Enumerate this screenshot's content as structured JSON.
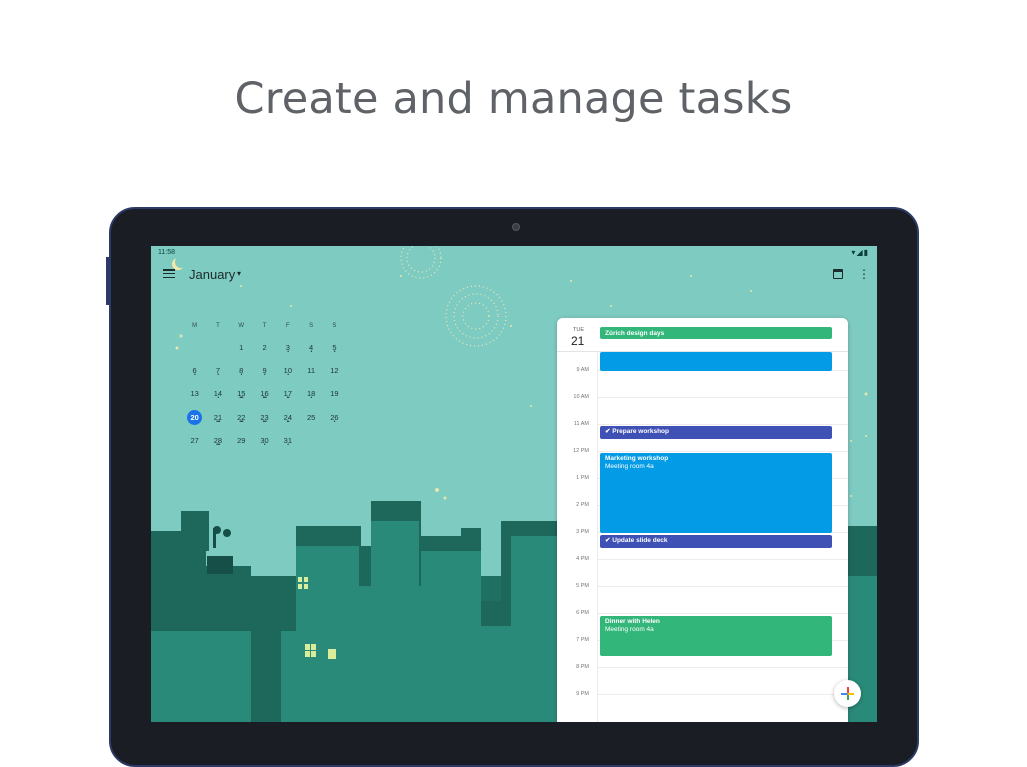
{
  "headline": "Create and manage tasks",
  "status_bar": {
    "time": "11:58",
    "icons": "▾◢▮"
  },
  "app_bar": {
    "month": "January",
    "caret": "▾",
    "more": "⋮"
  },
  "mini_calendar": {
    "weekdays": [
      "M",
      "T",
      "W",
      "T",
      "F",
      "S",
      "S"
    ],
    "weeks": [
      [
        {
          "d": ""
        },
        {
          "d": ""
        },
        {
          "d": "1"
        },
        {
          "d": "2"
        },
        {
          "d": "3",
          "dots": "•"
        },
        {
          "d": "4",
          "dots": "•"
        },
        {
          "d": "5",
          "dots": "•"
        }
      ],
      [
        {
          "d": "6",
          "dots": "•"
        },
        {
          "d": "7",
          "dots": "•"
        },
        {
          "d": "8",
          "dots": "•"
        },
        {
          "d": "9",
          "dots": "•"
        },
        {
          "d": "10",
          "dots": "•"
        },
        {
          "d": "11"
        },
        {
          "d": "12"
        }
      ],
      [
        {
          "d": "13"
        },
        {
          "d": "14",
          "dots": "•"
        },
        {
          "d": "15",
          "dots": "•••"
        },
        {
          "d": "16",
          "dots": "•••"
        },
        {
          "d": "17",
          "dots": "••"
        },
        {
          "d": "18",
          "dots": "•"
        },
        {
          "d": "19"
        }
      ],
      [
        {
          "d": "20",
          "today": true
        },
        {
          "d": "21",
          "dots": "•••"
        },
        {
          "d": "22",
          "dots": "•••"
        },
        {
          "d": "23",
          "dots": "•••"
        },
        {
          "d": "24",
          "dots": "••"
        },
        {
          "d": "25"
        },
        {
          "d": "26",
          "dots": "•"
        }
      ],
      [
        {
          "d": "27"
        },
        {
          "d": "28",
          "dots": "•••"
        },
        {
          "d": "29"
        },
        {
          "d": "30",
          "dots": "•"
        },
        {
          "d": "31",
          "dots": "•"
        },
        {
          "d": ""
        },
        {
          "d": ""
        }
      ]
    ]
  },
  "day_panel": {
    "weekday": "TUE",
    "day": "21",
    "all_day_event": "Zürich design days",
    "hours": [
      "9 AM",
      "10 AM",
      "11 AM",
      "12 PM",
      "1 PM",
      "2 PM",
      "3 PM",
      "4 PM",
      "5 PM",
      "6 PM",
      "7 PM",
      "8 PM",
      "9 PM"
    ],
    "events": {
      "morning": "",
      "prepare": "Prepare workshop",
      "marketing_title": "Marketing workshop",
      "marketing_room": "Meeting room 4a",
      "update": "Update slide deck",
      "dinner_title": "Dinner with Helen",
      "dinner_room": "Meeting room 4a"
    },
    "check_glyph": "✔"
  },
  "colors": {
    "accent": "#1a73e8",
    "green": "#33b679",
    "blue": "#039be5",
    "indigo": "#3f51b5",
    "sky": "#7ecbc2"
  }
}
